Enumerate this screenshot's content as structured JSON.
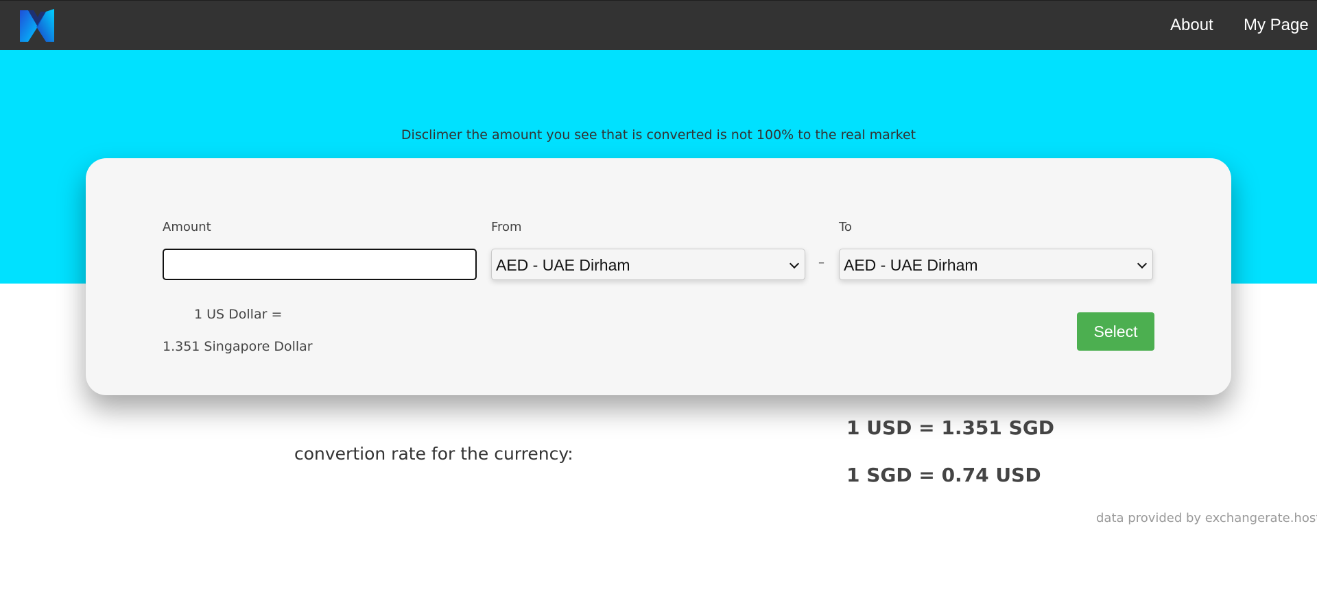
{
  "nav": {
    "logo_icon": "m-logo-icon",
    "about_label": "About",
    "mypage_label": "My Page"
  },
  "hero": {
    "disclaimer": "Disclimer the amount you see that is converted is not 100% to the real market"
  },
  "converter": {
    "amount_label": "Amount",
    "amount_value": "",
    "from_label": "From",
    "from_selected": "AED - UAE Dirham",
    "to_label": "To",
    "to_selected": "AED - UAE Dirham",
    "separator": "–",
    "usd_line": "1 US Dollar =",
    "sgd_line": "1.351 Singapore Dollar",
    "select_button_label": "Select"
  },
  "rates": {
    "label": "convertion rate for the currency:",
    "usd_to_sgd": "1 USD = 1.351 SGD",
    "sgd_to_usd": "1 SGD = 0.74 USD"
  },
  "footer": {
    "credit": "data provided by exchangerate.host api"
  },
  "colors": {
    "navbar": "#333333",
    "hero": "#00e1ff",
    "card": "#f6f6f6",
    "button": "#4caf50"
  }
}
